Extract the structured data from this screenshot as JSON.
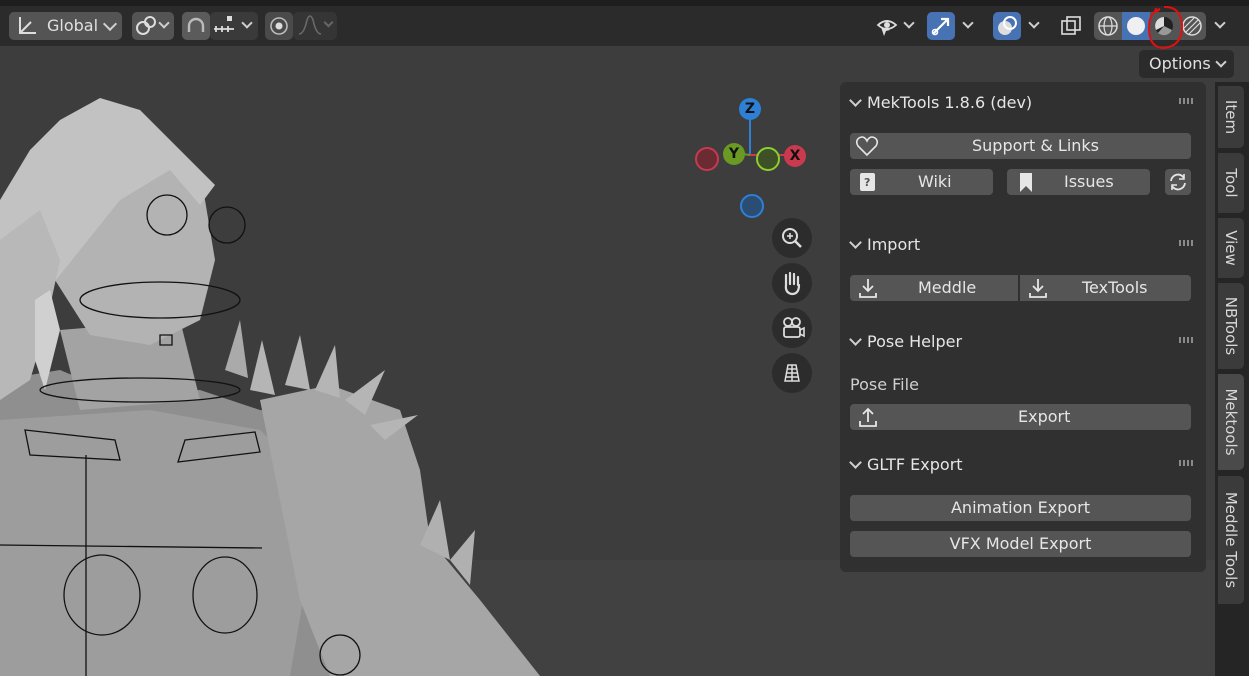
{
  "header": {
    "orientation_label": "Global",
    "options_label": "Options"
  },
  "panel": {
    "mektools": {
      "title": "MekTools 1.8.6 (dev)",
      "support_label": "Support & Links",
      "wiki_label": "Wiki",
      "issues_label": "Issues"
    },
    "import": {
      "title": "Import",
      "meddle_label": "Meddle",
      "textools_label": "TexTools"
    },
    "pose_helper": {
      "title": "Pose Helper",
      "pose_file_label": "Pose File",
      "export_label": "Export"
    },
    "gltf_export": {
      "title": "GLTF Export",
      "animation_label": "Animation Export",
      "vfx_label": "VFX Model Export"
    }
  },
  "sidebar_tabs": [
    "Item",
    "Tool",
    "View",
    "NBTools",
    "Mektools",
    "Meddle Tools"
  ],
  "gizmo": {
    "z": "Z",
    "y": "Y",
    "x": "X"
  },
  "colors": {
    "accent": "#4772b3",
    "x_axis": "#c93a4e",
    "y_axis": "#6a9a23",
    "z_axis": "#2e80d6"
  }
}
